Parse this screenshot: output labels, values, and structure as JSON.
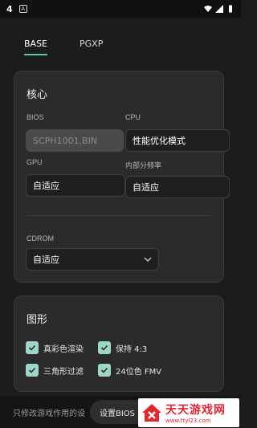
{
  "status": {
    "time": "4",
    "notif_letter": "A"
  },
  "tabs": [
    {
      "label": "BASE",
      "active": true
    },
    {
      "label": "PGXP",
      "active": false
    }
  ],
  "core": {
    "title": "核心",
    "bios_label": "BIOS",
    "bios_value": "SCPH1001.BIN",
    "cpu_label": "CPU",
    "cpu_value": "性能优化模式",
    "gpu_label": "GPU",
    "gpu_value": "自适应",
    "freq_label": "内部分频率",
    "freq_value": "自适应",
    "cdrom_label": "CDROM",
    "cdrom_value": "自适应"
  },
  "graphics": {
    "title": "图形",
    "options": [
      {
        "label": "真彩色渲染",
        "checked": true
      },
      {
        "label": "保持 4:3",
        "checked": true
      },
      {
        "label": "三角形过滤",
        "checked": true
      },
      {
        "label": "24位色 FMV",
        "checked": true
      }
    ]
  },
  "bottom": {
    "hint": "只修改游戏作用的设",
    "button": "设置BIOS"
  },
  "watermark": {
    "text": "天天游戏网",
    "url": "www.ttyl23.com"
  },
  "colors": {
    "accent": "#5cc7b2",
    "checkbox": "#9fd6ca",
    "watermark": "#e0262f"
  }
}
